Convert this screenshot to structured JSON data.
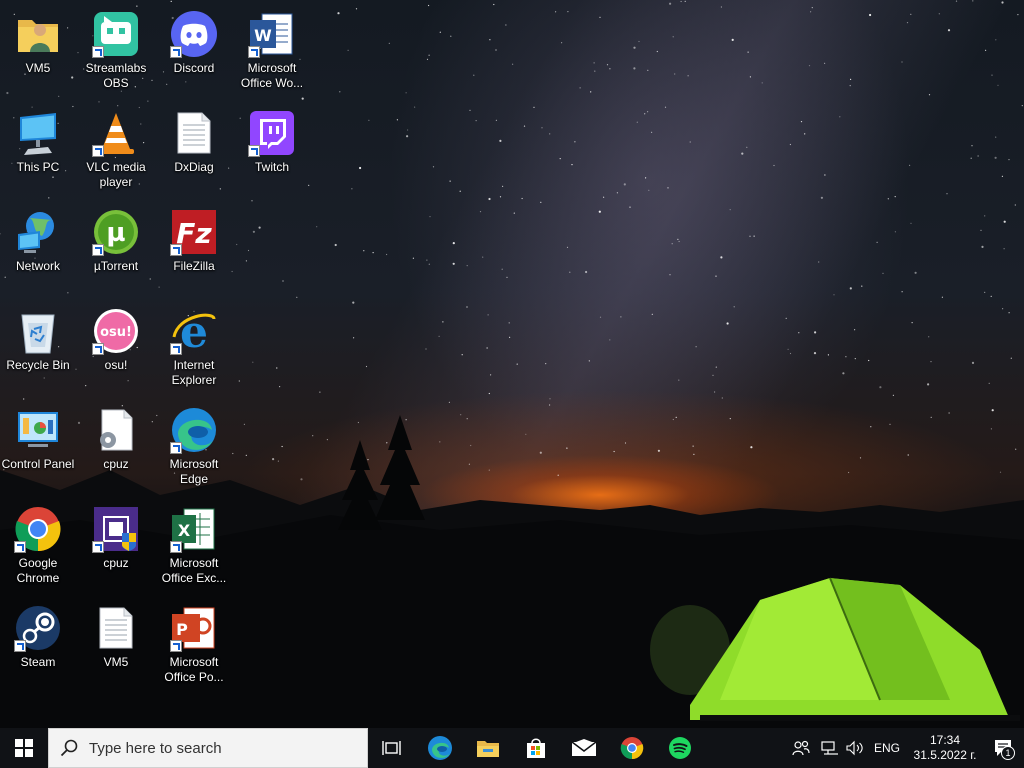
{
  "desktop": {
    "icons": [
      {
        "label": "VM5",
        "icon": "user-folder-icon"
      },
      {
        "label": "This PC",
        "icon": "computer-icon"
      },
      {
        "label": "Network",
        "icon": "network-icon"
      },
      {
        "label": "Recycle Bin",
        "icon": "recycle-bin-icon"
      },
      {
        "label": "Control Panel",
        "icon": "control-panel-icon"
      },
      {
        "label": "Google Chrome",
        "icon": "chrome-icon"
      },
      {
        "label": "Steam",
        "icon": "steam-icon"
      },
      {
        "label": "Streamlabs OBS",
        "icon": "streamlabs-icon"
      },
      {
        "label": "VLC media player",
        "icon": "vlc-icon"
      },
      {
        "label": "µTorrent",
        "icon": "utorrent-icon"
      },
      {
        "label": "osu!",
        "icon": "osu-icon"
      },
      {
        "label": "cpuz",
        "icon": "settings-file-icon"
      },
      {
        "label": "cpuz",
        "icon": "cpuz-icon"
      },
      {
        "label": "VM5",
        "icon": "text-file-icon"
      },
      {
        "label": "Discord",
        "icon": "discord-icon"
      },
      {
        "label": "DxDiag",
        "icon": "text-file-icon"
      },
      {
        "label": "FileZilla",
        "icon": "filezilla-icon"
      },
      {
        "label": "Internet Explorer",
        "icon": "internet-explorer-icon"
      },
      {
        "label": "Microsoft Edge",
        "icon": "edge-icon"
      },
      {
        "label": "Microsoft Office Exc...",
        "icon": "excel-icon"
      },
      {
        "label": "Microsoft Office Po...",
        "icon": "powerpoint-icon"
      },
      {
        "label": "Microsoft Office Wo...",
        "icon": "word-icon"
      },
      {
        "label": "Twitch",
        "icon": "twitch-icon"
      }
    ]
  },
  "taskbar": {
    "search_placeholder": "Type here to search",
    "pinned": [
      "task-view-icon",
      "edge-icon",
      "file-explorer-icon",
      "store-icon",
      "mail-icon",
      "chrome-icon",
      "spotify-icon"
    ],
    "tray": {
      "language": "ENG",
      "time": "17:34",
      "date": "31.5.2022 г.",
      "notification_count": "1"
    }
  },
  "colors": {
    "taskbar_bg": "#101216",
    "search_bg": "#f3f3f3",
    "tent_green": "#8fdc2a"
  }
}
